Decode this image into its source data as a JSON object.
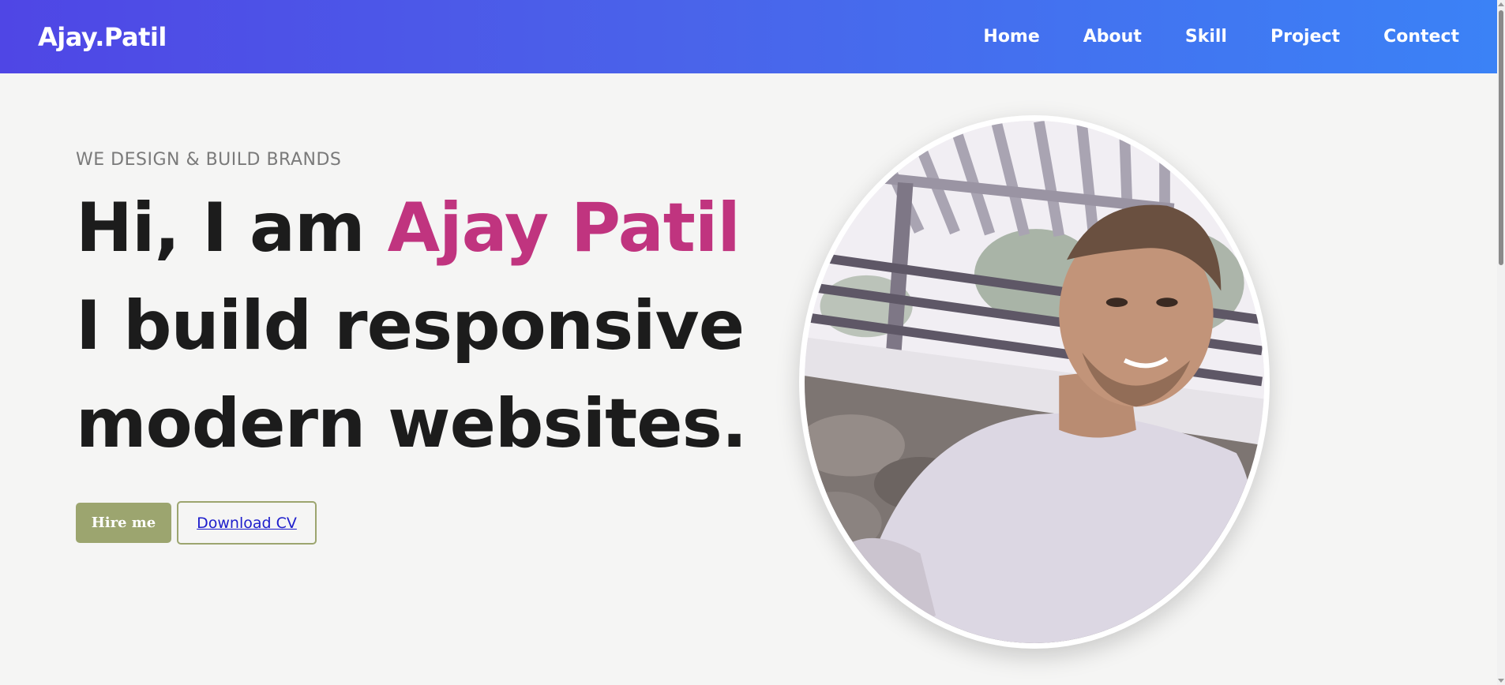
{
  "header": {
    "logo": "Ajay.Patil",
    "nav": [
      {
        "label": "Home"
      },
      {
        "label": "About"
      },
      {
        "label": "Skill"
      },
      {
        "label": "Project"
      },
      {
        "label": "Contect"
      }
    ]
  },
  "hero": {
    "tagline": "WE DESIGN & BUILD BRANDS",
    "greeting": "Hi, I am ",
    "name": "Ajay Patil",
    "line2": "I build responsive",
    "line3": "modern websites.",
    "hire_label": "Hire me",
    "cv_label": "Download CV",
    "photo": "profile-photo"
  },
  "colors": {
    "nav_gradient_start": "#4f46e5",
    "nav_gradient_end": "#3b82f6",
    "accent": "#c0347f",
    "button": "#9ca56f",
    "background": "#f5f5f4"
  }
}
